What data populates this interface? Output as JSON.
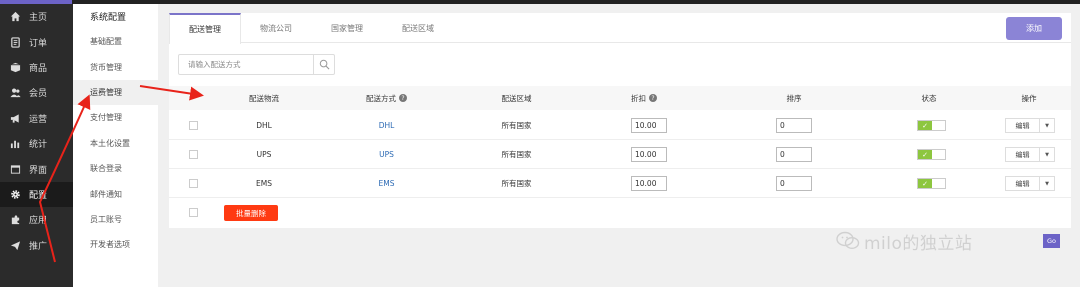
{
  "nav": {
    "items": [
      {
        "label": "主页",
        "icon": "home-icon"
      },
      {
        "label": "订单",
        "icon": "order-icon"
      },
      {
        "label": "商品",
        "icon": "product-box-icon"
      },
      {
        "label": "会员",
        "icon": "members-icon"
      },
      {
        "label": "运营",
        "icon": "megaphone-icon"
      },
      {
        "label": "统计",
        "icon": "bar-chart-icon"
      },
      {
        "label": "界面",
        "icon": "layout-icon"
      },
      {
        "label": "配置",
        "icon": "gear-icon"
      },
      {
        "label": "应用",
        "icon": "puzzle-icon"
      },
      {
        "label": "推广",
        "icon": "paper-plane-icon"
      }
    ],
    "active_index": 7
  },
  "subnav": {
    "title": "系统配置",
    "items": [
      "基础配置",
      "货币管理",
      "运费管理",
      "支付管理",
      "本土化设置",
      "联合登录",
      "邮件通知",
      "员工账号",
      "开发者选项"
    ],
    "active_index": 2
  },
  "tabs": [
    "配送管理",
    "物流公司",
    "国家管理",
    "配送区域"
  ],
  "add_button": "添加",
  "search": {
    "placeholder": "请输入配送方式"
  },
  "table": {
    "headers": {
      "carrier": "配送物流",
      "method": "配送方式",
      "region": "配送区域",
      "discount": "折扣",
      "sort": "排序",
      "status": "状态",
      "actions": "操作"
    },
    "rows": [
      {
        "carrier": "DHL",
        "method": "DHL",
        "region": "所有国家",
        "discount": "10.00",
        "sort": "0",
        "status_on": "✓",
        "edit": "编辑"
      },
      {
        "carrier": "UPS",
        "method": "UPS",
        "region": "所有国家",
        "discount": "10.00",
        "sort": "0",
        "status_on": "✓",
        "edit": "编辑"
      },
      {
        "carrier": "EMS",
        "method": "EMS",
        "region": "所有国家",
        "discount": "10.00",
        "sort": "0",
        "status_on": "✓",
        "edit": "编辑"
      }
    ]
  },
  "batch_delete": "批量删除",
  "go_button": "Go",
  "watermark": "milo的独立站",
  "colors": {
    "accent": "#8b84d6",
    "danger": "#ff3a12",
    "toggle_on": "#8dc63f",
    "link": "#2d6bb5",
    "annotation": "#e8231a"
  }
}
